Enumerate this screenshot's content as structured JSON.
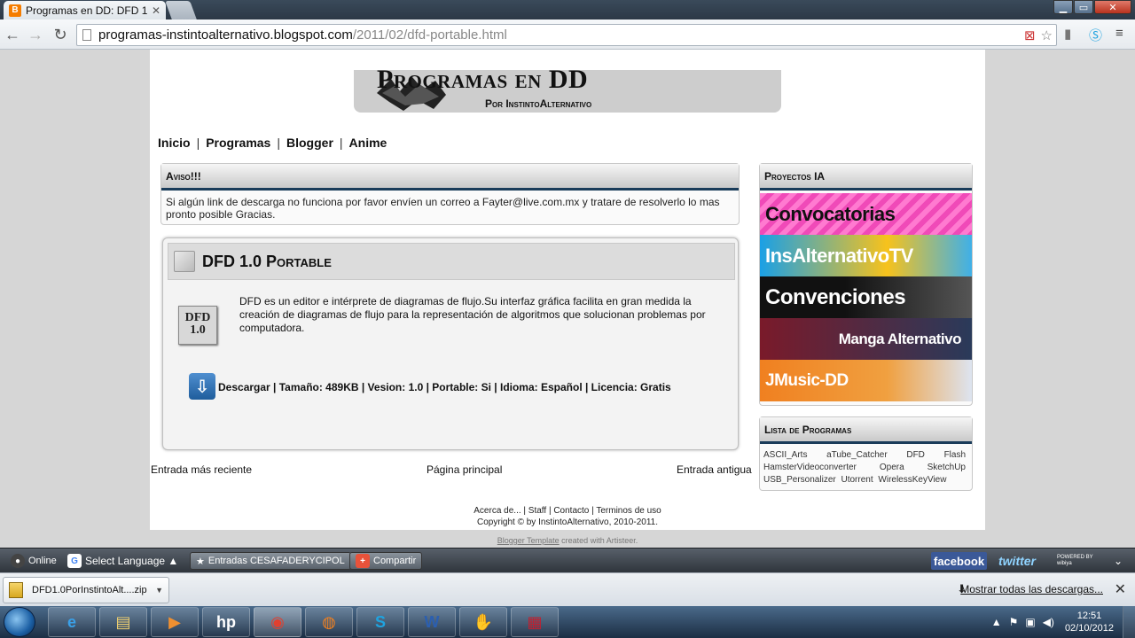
{
  "browser": {
    "tab_title": "Programas en DD: DFD 1.0",
    "tab_favicon": "B",
    "url_host": "programas-instintoalternativo.blogspot.com",
    "url_path": "/2011/02/dfd-portable.html"
  },
  "site": {
    "title": "Programas en DD",
    "subtitle": "Por InstintoAlternativo",
    "logo_text": "Instinto Alternativo"
  },
  "nav": [
    "Inicio",
    "Programas",
    "Blogger",
    "Anime"
  ],
  "aviso": {
    "heading": "Aviso!!!",
    "text": "Si algún link de descarga no funciona por favor envíen un correo a Fayter@live.com.mx y tratare de resolverlo lo mas pronto posible Gracias."
  },
  "post": {
    "title": "DFD 1.0 Portable",
    "logo_text": "DFD 1.0",
    "description": "DFD es un editor e intérprete de diagramas de flujo.Su interfaz gráfica facilita en gran medida la creación de diagramas de flujo para la representación de algoritmos que solucionan problemas por computadora.",
    "download_line": "Descargar | Tamaño: 489KB | Vesion: 1.0 | Portable: Si | Idioma: Español | Licencia: Gratis"
  },
  "pager": {
    "newer": "Entrada más reciente",
    "home": "Página principal",
    "older": "Entrada antigua"
  },
  "sidebar": {
    "proyectos_heading": "Proyectos IA",
    "promos": [
      "Convocatorias",
      "InsAlternativoTV",
      "Convenciones",
      "Manga Alternativo",
      "JMusic-DD"
    ],
    "lista_heading": "Lista de Programas",
    "programs": [
      "ASCII_Arts",
      "aTube_Catcher",
      "DFD",
      "Flash",
      "HamsterVideoconverter",
      "Opera",
      "SketchUp",
      "USB_Personalizer",
      "Utorrent",
      "WirelessKeyView"
    ]
  },
  "footer": {
    "links": [
      "Acerca de...",
      "Staff",
      "Contacto",
      "Terminos de uso"
    ],
    "copyright": "Copyright © by InstintoAlternativo, 2010-2011.",
    "credits_link": "Blogger Template",
    "credits_rest": "created with Artisteer."
  },
  "blogbar": {
    "online": "Online",
    "language": "Select Language ▲",
    "entradas": "Entradas CESAFADERYCIPOL",
    "compartir": "Compartir",
    "facebook": "facebook",
    "twitter": "twitter",
    "powered": "POWERED BY wibiya"
  },
  "downloads": {
    "file": "DFD1.0PorInstintoAlt....zip",
    "show_all": "Mostrar todas las descargas..."
  },
  "taskbar": {
    "time": "12:51",
    "date": "02/10/2012"
  }
}
